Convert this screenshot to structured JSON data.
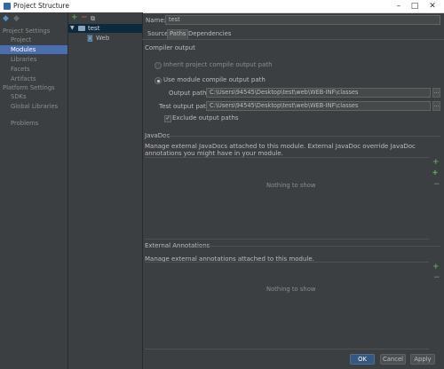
{
  "window": {
    "title": "Project Structure"
  },
  "nav": {
    "sections": [
      {
        "label": "Project Settings"
      },
      {
        "label": "Platform Settings"
      }
    ],
    "project_items": [
      "Project",
      "Modules",
      "Libraries",
      "Facets",
      "Artifacts"
    ],
    "platform_items": [
      "SDKs",
      "Global Libraries"
    ],
    "problems": "Problems"
  },
  "tree": {
    "root": "test",
    "child": "Web"
  },
  "module": {
    "name_label": "Name:",
    "name_value": "test",
    "tabs": [
      "Sources",
      "Paths",
      "Dependencies"
    ]
  },
  "compiler": {
    "section": "Compiler output",
    "inherit_label": "Inherit project compile output path",
    "use_module_label": "Use module compile output path",
    "output_label": "Output path:",
    "output_value": "C:\\Users\\94545\\Desktop\\test\\web\\WEB-INF\\classes",
    "test_output_label": "Test output path:",
    "test_output_value": "C:\\Users\\94545\\Desktop\\test\\web\\WEB-INF\\classes",
    "exclude_label": "Exclude output paths",
    "browse": "..."
  },
  "javadoc": {
    "section": "JavaDoc",
    "description": "Manage external JavaDocs attached to this module. External JavaDoc override JavaDoc annotations you might have in your module.",
    "empty": "Nothing to show"
  },
  "annotations": {
    "section": "External Annotations",
    "description": "Manage external annotations attached to this module.",
    "empty": "Nothing to show"
  },
  "buttons": {
    "ok": "OK",
    "cancel": "Cancel",
    "apply": "Apply"
  }
}
